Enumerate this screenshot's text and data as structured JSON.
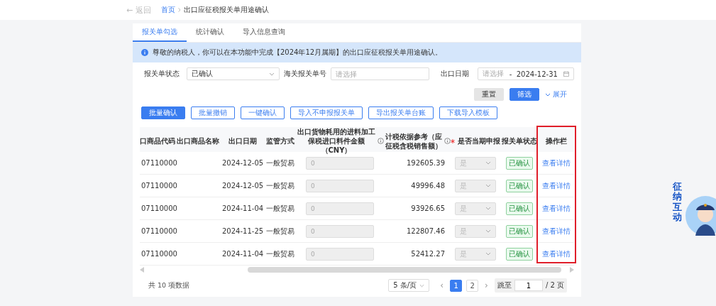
{
  "header": {
    "back": "← 返回",
    "breadcrumb": [
      {
        "label": "首页",
        "selected": false
      },
      {
        "label": "出口应征税报关单用途确认",
        "selected": true
      }
    ]
  },
  "tabs": [
    {
      "label": "报关单勾选",
      "selected": true
    },
    {
      "label": "统计确认",
      "selected": false
    },
    {
      "label": "导入信息查询",
      "selected": false
    }
  ],
  "notice": "尊敬的纳税人，你可以在本功能中完成【2024年12月属期】的出口应征税报关单用途确认。",
  "filters": {
    "status_label": "报关单状态",
    "status_value": "已确认",
    "number_label": "海关报关单号",
    "number_placeholder": "请选择",
    "date_label": "出口日期",
    "date_start_placeholder": "请选择",
    "date_separator": "-",
    "date_end": "2024-12-31"
  },
  "filter_actions": {
    "reset": "重置",
    "search": "筛选",
    "expand": "展开"
  },
  "actions": [
    {
      "label": "批量确认",
      "kind": "primary"
    },
    {
      "label": "批量撤销",
      "kind": "outline"
    },
    {
      "label": "一键确认",
      "kind": "outline"
    },
    {
      "label": "导入不申报报关单",
      "kind": "outline"
    },
    {
      "label": "导出报关单台账",
      "kind": "outline"
    },
    {
      "label": "下载导入模板",
      "kind": "outline"
    }
  ],
  "table": {
    "columns": [
      {
        "label": "口商品代码",
        "kind": "plain"
      },
      {
        "label": "出口商品名称",
        "kind": "plain"
      },
      {
        "label": "出口日期",
        "kind": "plain"
      },
      {
        "label": "监管方式",
        "kind": "plain"
      },
      {
        "label": "出口货物耗用的进料加工保税进口料件金额（CNY）",
        "kind": "info"
      },
      {
        "label": "计税依据参考（应征税含税销售额）",
        "kind": "info"
      },
      {
        "label": "是否当期申报",
        "kind": "required"
      },
      {
        "label": "报关单状态",
        "kind": "plain"
      },
      {
        "label": "操作栏",
        "kind": "plain"
      }
    ],
    "rows": [
      {
        "code": "07110000",
        "date": "2024-12-05",
        "method": "一般贸易",
        "amount": "0",
        "reference": "192605.39",
        "declare": "是",
        "status": "已确认",
        "action": "查看详情"
      },
      {
        "code": "07110000",
        "date": "2024-12-05",
        "method": "一般贸易",
        "amount": "0",
        "reference": "49996.48",
        "declare": "是",
        "status": "已确认",
        "action": "查看详情"
      },
      {
        "code": "07110000",
        "date": "2024-11-04",
        "method": "一般贸易",
        "amount": "0",
        "reference": "93926.65",
        "declare": "是",
        "status": "已确认",
        "action": "查看详情"
      },
      {
        "code": "07110000",
        "date": "2024-11-25",
        "method": "一般贸易",
        "amount": "0",
        "reference": "122807.46",
        "declare": "是",
        "status": "已确认",
        "action": "查看详情"
      },
      {
        "code": "07110000",
        "date": "2024-11-04",
        "method": "一般贸易",
        "amount": "0",
        "reference": "52412.27",
        "declare": "是",
        "status": "已确认",
        "action": "查看详情"
      }
    ]
  },
  "pagination": {
    "total": "共 10 项数据",
    "page_size": "5 条/页",
    "prev": "‹",
    "pages": [
      {
        "label": "1",
        "selected": true
      },
      {
        "label": "2",
        "selected": false
      }
    ],
    "next": "›",
    "jump_label": "跳至",
    "jump_value": "1",
    "page_count": "/ 2 页"
  },
  "assistant": {
    "label": "征纳互动"
  }
}
